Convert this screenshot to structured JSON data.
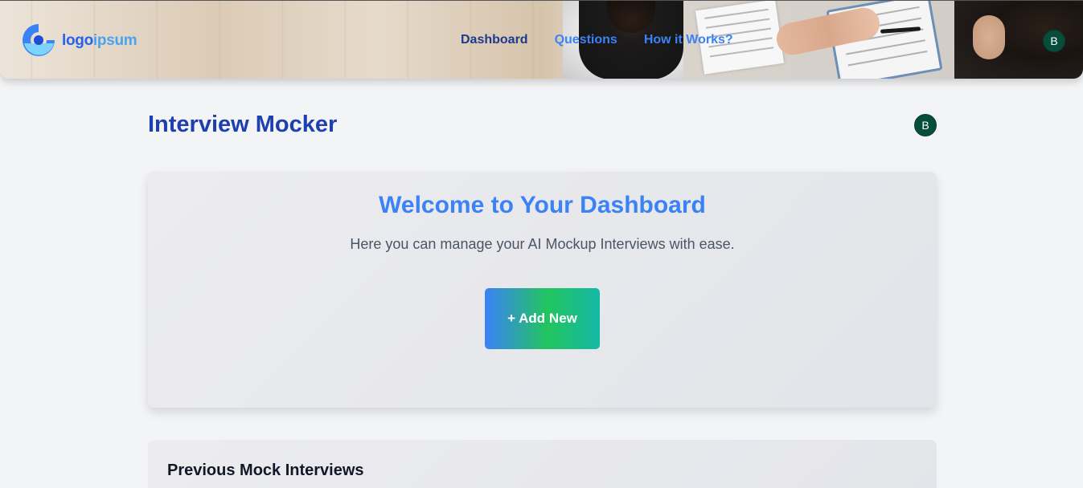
{
  "header": {
    "logo": {
      "part1": "logo",
      "part2": "ipsum"
    },
    "nav": [
      {
        "label": "Dashboard"
      },
      {
        "label": "Questions"
      },
      {
        "label": "How it Works?"
      }
    ],
    "avatar_initial": "B"
  },
  "main": {
    "title": "Interview Mocker",
    "avatar_initial": "B",
    "welcome": {
      "title": "Welcome to Your Dashboard",
      "subtitle": "Here you can manage your AI Mockup Interviews with ease.",
      "add_button": "+ Add New"
    },
    "previous": {
      "title": "Previous Mock Interviews"
    }
  },
  "colors": {
    "primary_dark": "#1e40af",
    "primary": "#3b82f6",
    "avatar_bg": "#064e3b",
    "button_gradient": [
      "#3b82f6",
      "#22c55e",
      "#14b8a6"
    ]
  },
  "icons": {
    "logo": "logo-mark-icon"
  }
}
